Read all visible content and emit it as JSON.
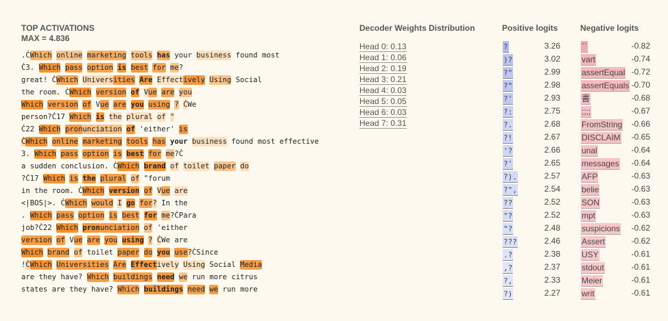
{
  "header": {
    "title": "TOP ACTIVATIONS",
    "max": "MAX = 4.836"
  },
  "sequences": [
    [
      [
        "."
      ],
      [
        "Ċ"
      ],
      [
        "Which",
        "#f7b36a"
      ],
      [
        " "
      ],
      [
        "online",
        "#f9c48a"
      ],
      [
        " "
      ],
      [
        "marketing",
        "#f7ae62"
      ],
      [
        " "
      ],
      [
        "tools",
        "#f9c48a"
      ],
      [
        " "
      ],
      [
        "has",
        "#f7ae62",
        1
      ],
      [
        " "
      ],
      [
        "your"
      ],
      [
        " "
      ],
      [
        "business",
        "#fde2c2"
      ],
      [
        " "
      ],
      [
        "found"
      ],
      [
        " "
      ],
      [
        "most"
      ]
    ],
    [
      [
        "Ċ"
      ],
      [
        "3"
      ],
      [
        "."
      ],
      [
        " "
      ],
      [
        "Which",
        "#f3922f"
      ],
      [
        " "
      ],
      [
        "pass",
        "#f59e45"
      ],
      [
        " "
      ],
      [
        "option",
        "#f6a654"
      ],
      [
        " "
      ],
      [
        "is",
        "#f49a3c",
        1
      ],
      [
        " "
      ],
      [
        "best",
        "#f59e45"
      ],
      [
        " "
      ],
      [
        "for",
        "#f6a654"
      ],
      [
        " "
      ],
      [
        "me",
        "#f9c48a"
      ],
      [
        "?"
      ]
    ],
    [
      [
        " "
      ],
      [
        "great"
      ],
      [
        "!"
      ],
      [
        " "
      ],
      [
        "Ċ"
      ],
      [
        "Which",
        "#f6a654"
      ],
      [
        " "
      ],
      [
        "Univers",
        "#fcdab3"
      ],
      [
        "ities",
        "#f59e45"
      ],
      [
        " "
      ],
      [
        "Are",
        "#f49a3c",
        1
      ],
      [
        " "
      ],
      [
        "Effect",
        "#fde2c2"
      ],
      [
        "ively",
        "#f49a3c"
      ],
      [
        " "
      ],
      [
        "Using",
        "#f9c48a"
      ],
      [
        " "
      ],
      [
        "Social"
      ]
    ],
    [
      [
        " "
      ],
      [
        "the"
      ],
      [
        " "
      ],
      [
        "room"
      ],
      [
        "."
      ],
      [
        " "
      ],
      [
        "Ċ"
      ],
      [
        "Which",
        "#f3922f"
      ],
      [
        " "
      ],
      [
        "version",
        "#f59e45"
      ],
      [
        " "
      ],
      [
        "of",
        "#f49a3c",
        1
      ],
      [
        " "
      ],
      [
        "V",
        "#fde2c2"
      ],
      [
        "ue",
        "#f6a654"
      ],
      [
        " "
      ],
      [
        "are",
        "#f6a654"
      ],
      [
        " "
      ],
      [
        "you",
        "#f9c48a"
      ]
    ],
    [
      [
        "Which",
        "#f3922f"
      ],
      [
        " "
      ],
      [
        "version",
        "#f59e45"
      ],
      [
        " "
      ],
      [
        "of",
        "#f49a3c"
      ],
      [
        " "
      ],
      [
        "V"
      ],
      [
        "ue",
        "#f59e45"
      ],
      [
        " "
      ],
      [
        "are",
        "#f59e45"
      ],
      [
        " "
      ],
      [
        "you",
        "#f49a3c",
        1
      ],
      [
        " "
      ],
      [
        "using",
        "#f59e45"
      ],
      [
        " "
      ],
      [
        "?",
        "#f9c48a"
      ],
      [
        " "
      ],
      [
        "Ċ",
        "#fde2c2"
      ],
      [
        "We"
      ]
    ],
    [
      [
        " "
      ],
      [
        "person"
      ],
      [
        "?"
      ],
      [
        "Ċ"
      ],
      [
        "17"
      ],
      [
        " "
      ],
      [
        "Which",
        "#f59e45"
      ],
      [
        " "
      ],
      [
        "is",
        "#f49a3c",
        1
      ],
      [
        " "
      ],
      [
        "the",
        "#fde2c2"
      ],
      [
        " "
      ],
      [
        "plural",
        "#fde2c2"
      ],
      [
        " "
      ],
      [
        "of",
        "#fde2c2"
      ],
      [
        " "
      ],
      [
        "\"",
        "#fde2c2"
      ]
    ],
    [
      [
        "Ċ"
      ],
      [
        "22"
      ],
      [
        " "
      ],
      [
        "Which",
        "#f3922f"
      ],
      [
        " "
      ],
      [
        "pron",
        "#f59e45"
      ],
      [
        "unciation",
        "#f9c48a"
      ],
      [
        " "
      ],
      [
        "of",
        "#f49a3c",
        1
      ],
      [
        " "
      ],
      [
        "'"
      ],
      [
        "either"
      ],
      [
        "'"
      ],
      [
        " "
      ],
      [
        "is",
        "#f59e45"
      ]
    ],
    [
      [
        "Ċ",
        "#fcdab3"
      ],
      [
        "Which",
        "#f3922f"
      ],
      [
        " "
      ],
      [
        "online",
        "#f59e45"
      ],
      [
        " "
      ],
      [
        "marketing",
        "#f59e45"
      ],
      [
        " "
      ],
      [
        "tools",
        "#f59e45"
      ],
      [
        " "
      ],
      [
        "has",
        "#f59e45"
      ],
      [
        " "
      ],
      [
        "your",
        "#fdf9ef",
        1
      ],
      [
        " "
      ],
      [
        "business",
        "#fde2c2"
      ],
      [
        " "
      ],
      [
        "found"
      ],
      [
        " "
      ],
      [
        "most"
      ],
      [
        " "
      ],
      [
        "effective"
      ]
    ],
    [
      [
        "3"
      ],
      [
        "."
      ],
      [
        " "
      ],
      [
        "Which",
        "#f3922f"
      ],
      [
        " "
      ],
      [
        "pass",
        "#f59e45"
      ],
      [
        " "
      ],
      [
        "option",
        "#f59e45"
      ],
      [
        " "
      ],
      [
        "is",
        "#f59e45"
      ],
      [
        " "
      ],
      [
        "best",
        "#f49a3c",
        1
      ],
      [
        " "
      ],
      [
        "for",
        "#f59e45"
      ],
      [
        " "
      ],
      [
        "me",
        "#f9c48a"
      ],
      [
        "?"
      ],
      [
        "Ċ"
      ]
    ],
    [
      [
        " "
      ],
      [
        "a"
      ],
      [
        " "
      ],
      [
        "sudden"
      ],
      [
        " "
      ],
      [
        "conclusion"
      ],
      [
        "."
      ],
      [
        " "
      ],
      [
        "Ċ"
      ],
      [
        "Which",
        "#f3922f"
      ],
      [
        " "
      ],
      [
        "brand",
        "#f49a3c",
        1
      ],
      [
        " "
      ],
      [
        "of",
        "#fde2c2"
      ],
      [
        " "
      ],
      [
        "toilet",
        "#fde2c2"
      ],
      [
        " "
      ],
      [
        "paper",
        "#f9c48a"
      ],
      [
        " "
      ],
      [
        "do",
        "#fcdab3"
      ]
    ],
    [
      [
        "?"
      ],
      [
        "Ċ"
      ],
      [
        "17"
      ],
      [
        " "
      ],
      [
        "Which",
        "#f3922f"
      ],
      [
        " "
      ],
      [
        "is",
        "#f59e45"
      ],
      [
        " "
      ],
      [
        "the",
        "#f49a3c",
        1
      ],
      [
        " "
      ],
      [
        "plural",
        "#f59e45"
      ],
      [
        " "
      ],
      [
        "of",
        "#f9c48a"
      ],
      [
        " "
      ],
      [
        "\""
      ],
      [
        "forum"
      ]
    ],
    [
      [
        " "
      ],
      [
        "in"
      ],
      [
        " "
      ],
      [
        "the"
      ],
      [
        " "
      ],
      [
        "room"
      ],
      [
        "."
      ],
      [
        " "
      ],
      [
        "Ċ"
      ],
      [
        "Which",
        "#f3922f"
      ],
      [
        " "
      ],
      [
        "version",
        "#f49a3c",
        1
      ],
      [
        " "
      ],
      [
        "of",
        "#f59e45"
      ],
      [
        " "
      ],
      [
        "V",
        "#fde2c2"
      ],
      [
        "ue",
        "#f6a654"
      ],
      [
        " "
      ],
      [
        "are",
        "#fde2c2"
      ]
    ],
    [
      [
        "<|BOS|>"
      ],
      [
        "."
      ],
      [
        " "
      ],
      [
        "Ċ"
      ],
      [
        "Which",
        "#f59e45"
      ],
      [
        " "
      ],
      [
        "would",
        "#f6a654"
      ],
      [
        " "
      ],
      [
        "I",
        "#fcdab3"
      ],
      [
        " "
      ],
      [
        "go",
        "#f49a3c",
        1
      ],
      [
        " "
      ],
      [
        "for",
        "#f6a654"
      ],
      [
        "?",
        "#fde2c2"
      ],
      [
        " "
      ],
      [
        "In"
      ],
      [
        " "
      ],
      [
        "the"
      ]
    ],
    [
      [
        "."
      ],
      [
        " "
      ],
      [
        "Which",
        "#f3922f"
      ],
      [
        " "
      ],
      [
        "pass",
        "#f59e45"
      ],
      [
        " "
      ],
      [
        "option",
        "#f59e45"
      ],
      [
        " "
      ],
      [
        "is",
        "#f59e45"
      ],
      [
        " "
      ],
      [
        "best",
        "#f59e45"
      ],
      [
        " "
      ],
      [
        "for",
        "#f49a3c",
        1
      ],
      [
        " "
      ],
      [
        "me",
        "#f9c48a"
      ],
      [
        "?"
      ],
      [
        "Ċ"
      ],
      [
        "Para"
      ]
    ],
    [
      [
        " "
      ],
      [
        "job"
      ],
      [
        "?"
      ],
      [
        "Ċ"
      ],
      [
        "22"
      ],
      [
        " "
      ],
      [
        "Which",
        "#f3922f"
      ],
      [
        " "
      ],
      [
        "pron",
        "#f49a3c",
        1
      ],
      [
        "unciation",
        "#f59e45"
      ],
      [
        " "
      ],
      [
        "of",
        "#f9c48a"
      ],
      [
        " "
      ],
      [
        "'"
      ],
      [
        "either"
      ]
    ],
    [
      [
        " "
      ],
      [
        "version",
        "#f59e45"
      ],
      [
        " "
      ],
      [
        "of",
        "#f59e45"
      ],
      [
        " "
      ],
      [
        "V"
      ],
      [
        "ue",
        "#f59e45"
      ],
      [
        " "
      ],
      [
        "are",
        "#f59e45"
      ],
      [
        " "
      ],
      [
        "you",
        "#f59e45"
      ],
      [
        " "
      ],
      [
        "using",
        "#f49a3c",
        1
      ],
      [
        " "
      ],
      [
        "?",
        "#f9c48a"
      ],
      [
        " "
      ],
      [
        "Ċ",
        "#fde2c2"
      ],
      [
        "We"
      ],
      [
        " "
      ],
      [
        "are"
      ]
    ],
    [
      [
        "Which",
        "#f3922f"
      ],
      [
        " "
      ],
      [
        "brand",
        "#f59e45"
      ],
      [
        " "
      ],
      [
        "of",
        "#f9c48a"
      ],
      [
        " "
      ],
      [
        "toilet"
      ],
      [
        " "
      ],
      [
        "paper",
        "#f59e45"
      ],
      [
        " "
      ],
      [
        "do",
        "#f59e45"
      ],
      [
        " "
      ],
      [
        "you",
        "#f49a3c",
        1
      ],
      [
        " "
      ],
      [
        "use",
        "#f59e45"
      ],
      [
        "?",
        "#fde2c2"
      ],
      [
        "Ċ"
      ],
      [
        "Since"
      ]
    ],
    [
      [
        "!"
      ],
      [
        "Ċ",
        "#fcdab3"
      ],
      [
        "Which",
        "#f3922f"
      ],
      [
        " "
      ],
      [
        "Univers",
        "#f59e45"
      ],
      [
        "ities",
        "#f59e45"
      ],
      [
        " "
      ],
      [
        "Are",
        "#f59e45"
      ],
      [
        " "
      ],
      [
        "Effect",
        "#f49a3c",
        1
      ],
      [
        "ively",
        "#fde2c2"
      ],
      [
        " "
      ],
      [
        "Using",
        "#fde2c2"
      ],
      [
        " "
      ],
      [
        "Social"
      ],
      [
        " "
      ],
      [
        "Media",
        "#f59e45"
      ]
    ],
    [
      [
        " "
      ],
      [
        "are"
      ],
      [
        " "
      ],
      [
        "they"
      ],
      [
        " "
      ],
      [
        "have"
      ],
      [
        "?"
      ],
      [
        " "
      ],
      [
        "Which",
        "#f59e45"
      ],
      [
        " "
      ],
      [
        "buildings",
        "#f59e45"
      ],
      [
        " "
      ],
      [
        "need",
        "#f49a3c",
        1
      ],
      [
        " "
      ],
      [
        "we",
        "#f9c48a"
      ],
      [
        " "
      ],
      [
        "run"
      ],
      [
        " "
      ],
      [
        "more"
      ],
      [
        " "
      ],
      [
        "citrus"
      ]
    ],
    [
      [
        " "
      ],
      [
        "states"
      ],
      [
        " "
      ],
      [
        "are"
      ],
      [
        " "
      ],
      [
        "they"
      ],
      [
        " "
      ],
      [
        "have"
      ],
      [
        "?"
      ],
      [
        " "
      ],
      [
        "Which",
        "#f59e45"
      ],
      [
        " "
      ],
      [
        "buildings",
        "#f49a3c",
        1
      ],
      [
        " "
      ],
      [
        "need",
        "#f59e45"
      ],
      [
        " "
      ],
      [
        "we",
        "#f59e45"
      ],
      [
        " "
      ],
      [
        "run"
      ],
      [
        " "
      ],
      [
        "more"
      ]
    ]
  ],
  "decoder": {
    "title": "Decoder Weights Distribution",
    "heads": [
      "Head 0: 0.13",
      "Head 1: 0.06",
      "Head 2: 0.19",
      "Head 3: 0.21",
      "Head 4: 0.03",
      "Head 5: 0.05",
      "Head 6: 0.03",
      "Head 7: 0.31"
    ]
  },
  "positive": {
    "title": "Positive logits",
    "rows": [
      {
        "token": "?",
        "value": "3.26",
        "color": "#aebcf0"
      },
      {
        "token": ")?",
        "value": "3.02",
        "color": "#b9c5f2"
      },
      {
        "token": "?\"",
        "value": "2.99",
        "color": "#bcc8f3"
      },
      {
        "token": "?\"",
        "value": "2.98",
        "color": "#bcc8f3"
      },
      {
        "token": "?'",
        "value": "2.93",
        "color": "#c0cbf3"
      },
      {
        "token": "?:",
        "value": "2.75",
        "color": "#cad3f5"
      },
      {
        "token": "?.",
        "value": "2.68",
        "color": "#cdd6f6"
      },
      {
        "token": "?!",
        "value": "2.67",
        "color": "#cdd6f6"
      },
      {
        "token": "'?",
        "value": "2.66",
        "color": "#ced7f6"
      },
      {
        "token": "?'",
        "value": "2.65",
        "color": "#ced7f6"
      },
      {
        "token": "?).",
        "value": "2.57",
        "color": "#d3dbf7"
      },
      {
        "token": "?\",",
        "value": "2.54",
        "color": "#d5dcf7"
      },
      {
        "token": "??",
        "value": "2.52",
        "color": "#d6ddf7"
      },
      {
        "token": "\"?",
        "value": "2.52",
        "color": "#d6ddf7"
      },
      {
        "token": "\"?",
        "value": "2.48",
        "color": "#d8dff8"
      },
      {
        "token": "???",
        "value": "2.46",
        "color": "#d9e0f8"
      },
      {
        "token": ".?",
        "value": "2.38",
        "color": "#dde3f8"
      },
      {
        "token": ",?",
        "value": "2.37",
        "color": "#dee4f9"
      },
      {
        "token": "?,",
        "value": "2.33",
        "color": "#e0e5f9"
      },
      {
        "token": "?)",
        "value": "2.27",
        "color": "#e3e8f9"
      }
    ]
  },
  "negative": {
    "title": "Negative logits",
    "rows": [
      {
        "token": "``",
        "value": "-0.82",
        "color": "#f2a8ae"
      },
      {
        "token": "vart",
        "value": "-0.74",
        "color": "#f4b6bb"
      },
      {
        "token": "assertEqual",
        "value": "-0.72",
        "color": "#f4b8bd"
      },
      {
        "token": "assertEquals",
        "value": "-0.70",
        "color": "#f5bbc0"
      },
      {
        "token": "書",
        "value": "-0.68",
        "color": "#f5bec2"
      },
      {
        "token": ";;;;",
        "value": "-0.67",
        "color": "#f5bfc3"
      },
      {
        "token": "FromString",
        "value": "-0.66",
        "color": "#f6c1c5"
      },
      {
        "token": "DISCLAIM",
        "value": "-0.65",
        "color": "#f6c2c6"
      },
      {
        "token": "unal",
        "value": "-0.64",
        "color": "#f6c3c7"
      },
      {
        "token": "messages",
        "value": "-0.64",
        "color": "#f6c3c7"
      },
      {
        "token": "AFP",
        "value": "-0.63",
        "color": "#f6c5c9"
      },
      {
        "token": "belie",
        "value": "-0.63",
        "color": "#f6c5c9"
      },
      {
        "token": "SON",
        "value": "-0.63",
        "color": "#f6c5c9"
      },
      {
        "token": "mpt",
        "value": "-0.63",
        "color": "#f6c5c9"
      },
      {
        "token": "suspicions",
        "value": "-0.62",
        "color": "#f7c7ca"
      },
      {
        "token": "Assert",
        "value": "-0.62",
        "color": "#f7c7ca"
      },
      {
        "token": "USY",
        "value": "-0.61",
        "color": "#f7c9cc"
      },
      {
        "token": "stdout",
        "value": "-0.61",
        "color": "#f7c9cc"
      },
      {
        "token": "Meier",
        "value": "-0.61",
        "color": "#f7c9cc"
      },
      {
        "token": "writ",
        "value": "-0.61",
        "color": "#f7c9cc"
      }
    ]
  }
}
